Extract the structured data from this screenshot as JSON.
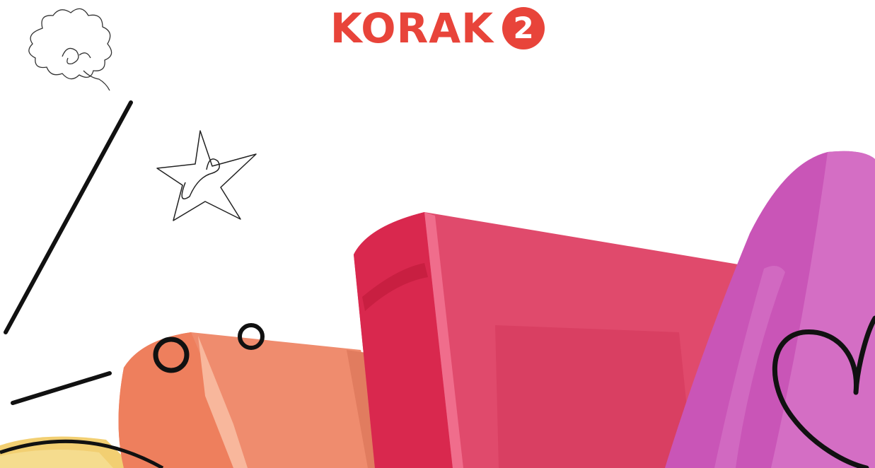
{
  "heading": {
    "title": "KORAK",
    "step_number": "2"
  },
  "colors": {
    "accent": "#e8443a",
    "red_book": "#e04a6c",
    "orange_book": "#ef8c6e",
    "purple_book": "#c955b7",
    "yellow": "#f2cf72",
    "ink": "#111111"
  },
  "decorations": [
    "doodle-cloud-icon",
    "doodle-star-icon",
    "heart-icon",
    "ring-icon"
  ]
}
